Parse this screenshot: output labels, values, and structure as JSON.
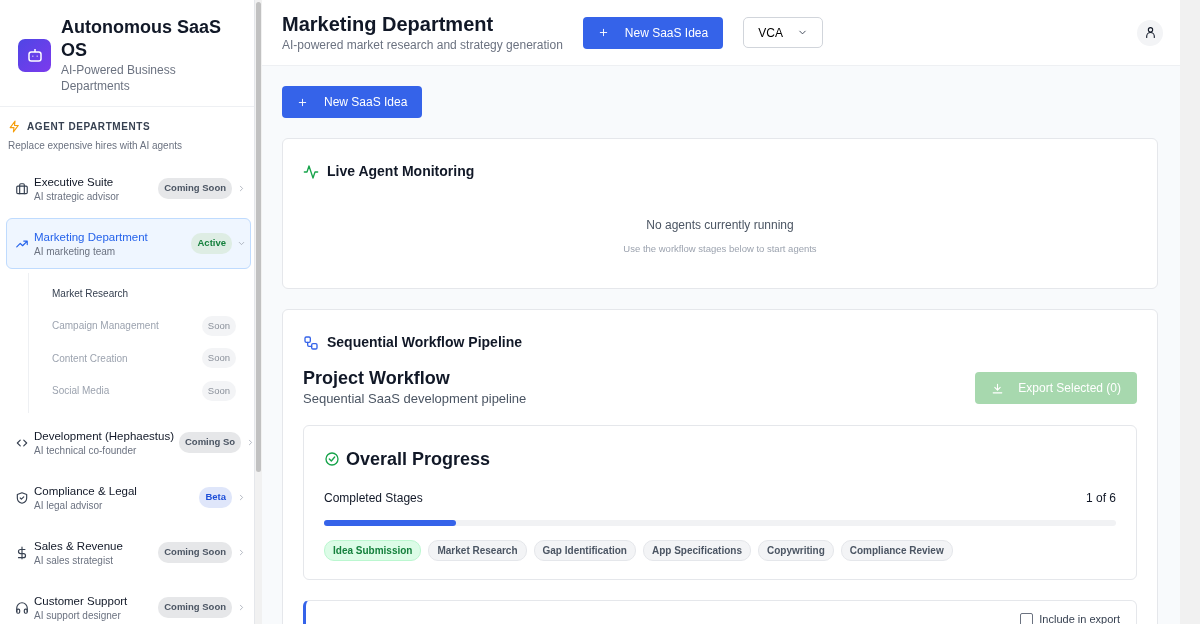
{
  "brand": {
    "title": "Autonomous SaaS OS",
    "subtitle": "AI-Powered Business Departments"
  },
  "sidebar": {
    "section_title": "AGENT DEPARTMENTS",
    "section_subtitle": "Replace expensive hires with AI agents",
    "items": [
      {
        "kind": "briefcase",
        "label": "Executive Suite",
        "description": "AI strategic advisor",
        "badge": "Coming Soon",
        "color": "#4b5563",
        "selected": false,
        "expanded": false
      },
      {
        "kind": "trend",
        "label": "Marketing Department",
        "description": "AI marketing team",
        "badge": "Active",
        "color": "#15803d",
        "selected": true,
        "expanded": true,
        "children": [
          {
            "label": "Market Research",
            "disabled": false
          },
          {
            "label": "Campaign Management",
            "disabled": true,
            "badge": "Soon"
          },
          {
            "label": "Content Creation",
            "disabled": true,
            "badge": "Soon"
          },
          {
            "label": "Social Media",
            "disabled": true,
            "badge": "Soon"
          }
        ]
      },
      {
        "kind": "code",
        "label": "Development (Hephaestus)",
        "description": "AI technical co-founder",
        "badge": "Coming So",
        "color": "#4b5563",
        "selected": false,
        "expanded": false
      },
      {
        "kind": "shield",
        "label": "Compliance & Legal",
        "description": "AI legal advisor",
        "badge": "Beta",
        "color": "#1d4ed8",
        "selected": false,
        "expanded": false
      },
      {
        "kind": "dollar",
        "label": "Sales & Revenue",
        "description": "AI sales strategist",
        "badge": "Coming Soon",
        "color": "#4b5563",
        "selected": false,
        "expanded": false
      },
      {
        "kind": "headset",
        "label": "Customer Support",
        "description": "AI support designer",
        "badge": "Coming Soon",
        "color": "#4b5563",
        "selected": false,
        "expanded": false
      }
    ]
  },
  "header": {
    "title": "Marketing Department",
    "subtitle": "AI-powered market research and strategy generation",
    "new_button": "New SaaS Idea",
    "project_select": "VCA"
  },
  "new_button": "New SaaS Idea",
  "monitoring": {
    "title": "Live Agent Monitoring",
    "empty_title": "No agents currently running",
    "empty_hint": "Use the workflow stages below to start agents"
  },
  "pipeline": {
    "title": "Sequential Workflow Pipeline",
    "heading": "Project Workflow",
    "subheading": "Sequential SaaS development pipeline",
    "export_button": "Export Selected (0)",
    "export_disabled": true,
    "progress": {
      "title": "Overall Progress",
      "label": "Completed Stages",
      "count": "1 of 6",
      "level": 0.167,
      "stages": [
        {
          "label": "Idea Submission",
          "completed": true
        },
        {
          "label": "Market Research",
          "completed": false
        },
        {
          "label": "Gap Identification",
          "completed": false
        },
        {
          "label": "App Specifications",
          "completed": false
        },
        {
          "label": "Copywriting",
          "completed": false
        },
        {
          "label": "Compliance Review",
          "completed": false
        }
      ]
    },
    "stage_card": {
      "include_label": "Include in export",
      "include_checked": false
    }
  }
}
